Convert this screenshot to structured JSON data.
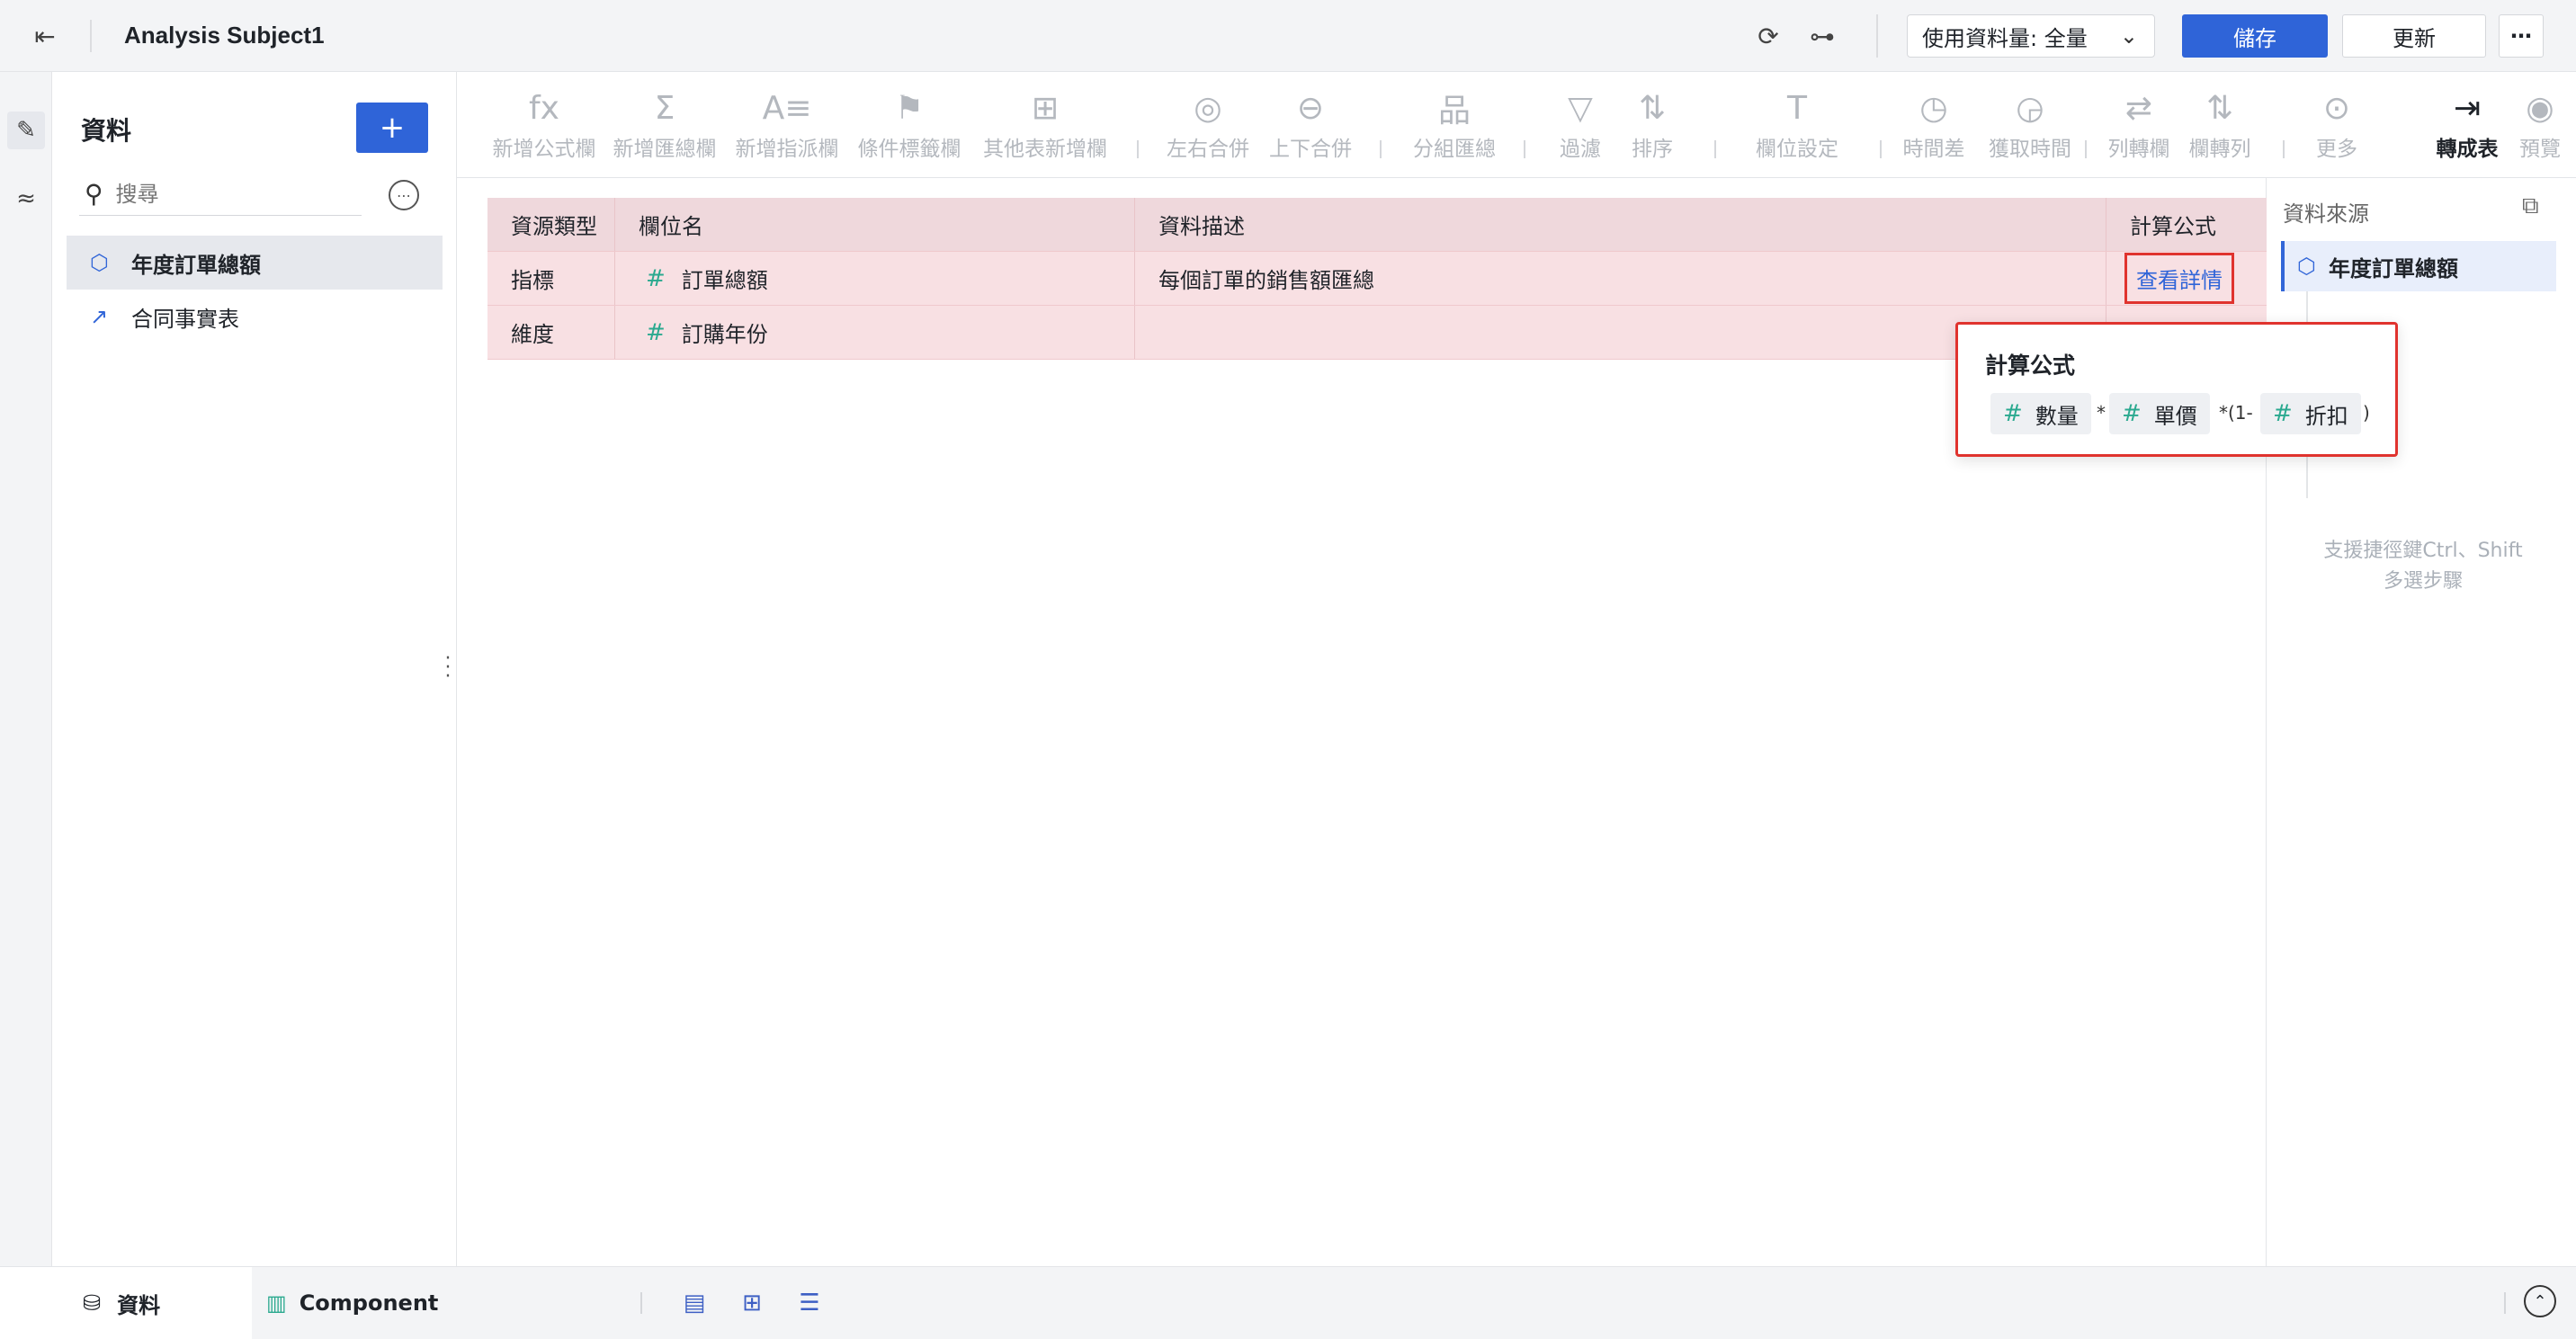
{
  "header": {
    "back_icon": "exit-icon",
    "title": "Analysis Subject1",
    "usage_label": "使用資料量: 全量",
    "save_label": "儲存",
    "refresh_label": "更新",
    "more_label": "⋯"
  },
  "rail": {
    "icons": [
      "edit-data-icon",
      "transform-icon"
    ]
  },
  "data_panel": {
    "title": "資料",
    "add_label": "+",
    "search_placeholder": "搜尋",
    "items": [
      {
        "label": "年度訂單總額",
        "icon": "cube-icon",
        "active": true
      },
      {
        "label": "合同事實表",
        "icon": "chart-icon",
        "active": false
      }
    ]
  },
  "toolbar": {
    "items": [
      {
        "label": "新增公式欄",
        "icon": "fx"
      },
      {
        "label": "新增匯總欄",
        "icon": "Σ"
      },
      {
        "label": "新增指派欄",
        "icon": "A≡"
      },
      {
        "label": "條件標籤欄",
        "icon": "⚑"
      },
      {
        "label": "其他表新增欄",
        "icon": "⊞"
      },
      {
        "label": "左右合併",
        "icon": "◎"
      },
      {
        "label": "上下合併",
        "icon": "⊖"
      },
      {
        "label": "分組匯總",
        "icon": "品"
      },
      {
        "label": "過濾",
        "icon": "▽"
      },
      {
        "label": "排序",
        "icon": "⇅"
      },
      {
        "label": "欄位設定",
        "icon": "T"
      },
      {
        "label": "時間差",
        "icon": "◷"
      },
      {
        "label": "獲取時間",
        "icon": "◶"
      },
      {
        "label": "列轉欄",
        "icon": "⇄"
      },
      {
        "label": "欄轉列",
        "icon": "⇅"
      },
      {
        "label": "更多",
        "icon": "⊙"
      },
      {
        "label": "轉成表",
        "icon": "⇥"
      },
      {
        "label": "預覽",
        "icon": "◉"
      }
    ]
  },
  "grid": {
    "headers": [
      "資源類型",
      "欄位名",
      "資料描述",
      "計算公式"
    ],
    "rows": [
      {
        "type": "指標",
        "field": "訂單總額",
        "desc": "每個訂單的銷售額匯總",
        "formula_link": "查看詳情"
      },
      {
        "type": "維度",
        "field": "訂購年份",
        "desc": "",
        "formula_link": ""
      }
    ]
  },
  "popover": {
    "title": "計算公式",
    "chips": [
      "數量",
      "單價",
      "折扣"
    ],
    "ops": [
      "*",
      "*(1-",
      ")"
    ]
  },
  "source_panel": {
    "title": "資料來源",
    "item": "年度訂單總額",
    "hint_line1": "支援捷徑鍵Ctrl、Shift",
    "hint_line2": "多選步驟"
  },
  "bottombar": {
    "tab_data": "資料",
    "tab_component": "Component"
  }
}
